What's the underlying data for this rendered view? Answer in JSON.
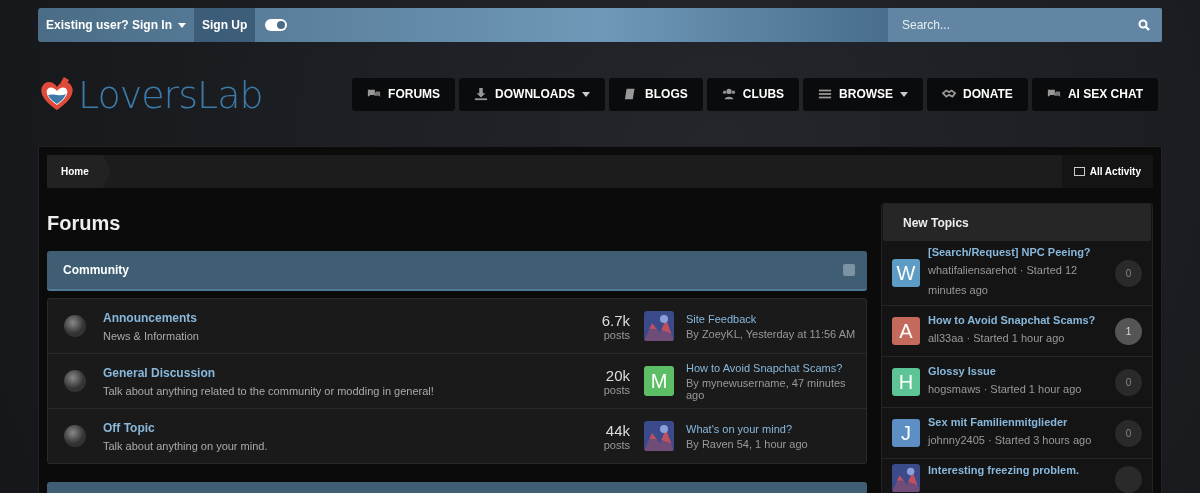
{
  "top_bar": {
    "sign_in": "Existing user? Sign In",
    "sign_up": "Sign Up",
    "theme_toggle": {
      "on": true
    },
    "search": {
      "placeholder": "Search..."
    }
  },
  "logo": {
    "text": "LoversLab"
  },
  "nav": [
    {
      "label": "FORUMS",
      "dropdown": false
    },
    {
      "label": "DOWNLOADS",
      "dropdown": true
    },
    {
      "label": "BLOGS",
      "dropdown": false
    },
    {
      "label": "CLUBS",
      "dropdown": false
    },
    {
      "label": "BROWSE",
      "dropdown": true
    },
    {
      "label": "DONATE",
      "dropdown": false
    },
    {
      "label": "AI SEX CHAT",
      "dropdown": false
    }
  ],
  "breadcrumb": {
    "items": [
      "Home"
    ],
    "all_activity": "All Activity"
  },
  "page_title": "Forums",
  "categories": [
    {
      "title": "Community",
      "forums": [
        {
          "name": "Announcements",
          "description": "News & Information",
          "count": "6.7k",
          "count_label": "posts",
          "last_post": {
            "title": "Site Feedback",
            "byline": "By ZoeyKL, Yesterday at 11:56 AM"
          }
        },
        {
          "name": "General Discussion",
          "description": "Talk about anything related to the community or modding in general!",
          "count": "20k",
          "count_label": "posts",
          "last_post": {
            "avatar": {
              "kind": "letter",
              "letter": "M",
              "color": "#5cbf66"
            },
            "title": "How to Avoid Snapchat Scams?",
            "byline": "By mynewusername, 47 minutes ago"
          }
        },
        {
          "name": "Off Topic",
          "description": "Talk about anything on your mind.",
          "count": "44k",
          "count_label": "posts",
          "last_post": {
            "title": "What's on your mind?",
            "byline": "By Raven 54, 1 hour ago"
          }
        }
      ]
    }
  ],
  "sidebar": {
    "title": "New Topics",
    "topics": [
      {
        "avatar": {
          "kind": "letter",
          "letter": "W",
          "color": "#5d9cc4"
        },
        "title": "[Search/Request] NPC Peeing?",
        "meta": "whatifaliensarehot · Started 12 minutes ago",
        "replies": "0",
        "highlighted": false
      },
      {
        "avatar": {
          "kind": "letter",
          "letter": "A",
          "color": "#c46a5d"
        },
        "title": "How to Avoid Snapchat Scams?",
        "meta": "all33aa · Started 1 hour ago",
        "replies": "1",
        "highlighted": true
      },
      {
        "avatar": {
          "kind": "letter",
          "letter": "H",
          "color": "#5dc495"
        },
        "title": "Glossy Issue",
        "meta": "hogsmaws · Started 1 hour ago",
        "replies": "0",
        "highlighted": false
      },
      {
        "avatar": {
          "kind": "letter",
          "letter": "J",
          "color": "#5d8fc4"
        },
        "title": "Sex mit Familienmitglieder",
        "meta": "johnny2405 · Started 3 hours ago",
        "replies": "0",
        "highlighted": false
      },
      {
        "title": "Interesting freezing problem.",
        "highlighted": false
      }
    ]
  }
}
